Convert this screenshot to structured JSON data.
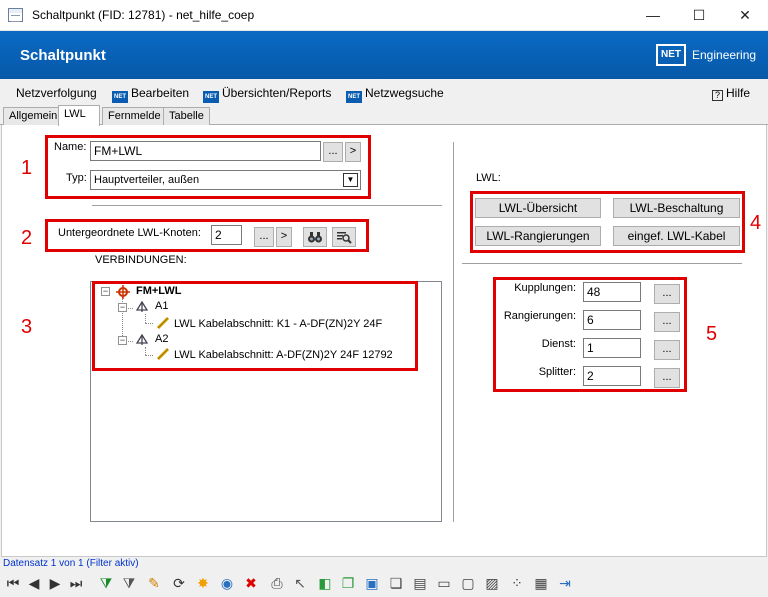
{
  "window": {
    "title": "Schaltpunkt (FID: 12781) - net_hilfe_coep",
    "minimize": "—",
    "maximize": "☐",
    "close": "✕"
  },
  "banner": {
    "title": "Schaltpunkt",
    "logo": "NET",
    "logo_text": "Engineering"
  },
  "menu": {
    "items": [
      "Netzverfolgung",
      "Bearbeiten",
      "Übersichten/Reports",
      "Netzwegsuche"
    ],
    "help": "Hilfe",
    "help_icon": "?",
    "net_icon": "NET"
  },
  "tabs": [
    "Allgemein",
    "LWL",
    "Fernmelde",
    "Tabelle"
  ],
  "active_tab": "LWL",
  "form": {
    "name_label": "Name:",
    "name_value": "FM+LWL",
    "name_more": "...",
    "name_go": ">",
    "typ_label": "Typ:",
    "typ_value": "Hauptverteiler, außen",
    "typ_dropdown": "▼",
    "sub_label": "Untergeordnete LWL-Knoten:",
    "sub_value": "2",
    "sub_more": "...",
    "sub_go": ">",
    "connections_label": "VERBINDUNGEN:"
  },
  "tree": {
    "expander": "−",
    "root": "FM+LWL",
    "children": [
      {
        "label": "A1",
        "cable": "LWL Kabelabschnitt: K1 - A-DF(ZN)2Y 24F"
      },
      {
        "label": "A2",
        "cable": "LWL Kabelabschnitt: A-DF(ZN)2Y 24F 12792"
      }
    ]
  },
  "lwl": {
    "label": "LWL:",
    "buttons": [
      "LWL-Übersicht",
      "LWL-Beschaltung",
      "LWL-Rangierungen",
      "eingef. LWL-Kabel"
    ]
  },
  "counts": {
    "more": "...",
    "rows": [
      {
        "label": "Kupplungen:",
        "value": "48"
      },
      {
        "label": "Rangierungen:",
        "value": "6"
      },
      {
        "label": "Dienst:",
        "value": "1"
      },
      {
        "label": "Splitter:",
        "value": "2"
      }
    ]
  },
  "markers": [
    "1",
    "2",
    "3",
    "4",
    "5"
  ],
  "status": "Datensatz 1 von 1 (Filter aktiv)",
  "toolbar_icons": [
    {
      "name": "first-record-icon",
      "glyph": "⏮",
      "color": "#333333"
    },
    {
      "name": "previous-record-icon",
      "glyph": "◀",
      "color": "#333333"
    },
    {
      "name": "next-record-icon",
      "glyph": "▶",
      "color": "#333333"
    },
    {
      "name": "last-record-icon",
      "glyph": "⏭",
      "color": "#333333"
    },
    {
      "name": "add-filter-icon",
      "glyph": "⧩",
      "color": "#1a8a2a"
    },
    {
      "name": "filter-icon",
      "glyph": "⧩",
      "color": "#555555"
    },
    {
      "name": "edit-pencil-icon",
      "glyph": "✎",
      "color": "#d08000"
    },
    {
      "name": "refresh-icon",
      "glyph": "⟳",
      "color": "#333333"
    },
    {
      "name": "new-record-icon",
      "glyph": "✸",
      "color": "#f0a000"
    },
    {
      "name": "globe-icon",
      "glyph": "◉",
      "color": "#2a70c0"
    },
    {
      "name": "delete-icon",
      "glyph": "✖",
      "color": "#e00000"
    },
    {
      "name": "print-icon",
      "glyph": "⎙",
      "color": "#444444"
    },
    {
      "name": "select-icon",
      "glyph": "↖",
      "color": "#555555"
    },
    {
      "name": "box-icon",
      "glyph": "◧",
      "color": "#2a9a3a"
    },
    {
      "name": "copy-icon",
      "glyph": "❐",
      "color": "#2a9a3a"
    },
    {
      "name": "frame-icon",
      "glyph": "▣",
      "color": "#2a70c0"
    },
    {
      "name": "window-copy-icon",
      "glyph": "❏",
      "color": "#444444"
    },
    {
      "name": "new-document-icon",
      "glyph": "▤",
      "color": "#444444"
    },
    {
      "name": "document-icon",
      "glyph": "▭",
      "color": "#444444"
    },
    {
      "name": "document-star-icon",
      "glyph": "▢",
      "color": "#444444"
    },
    {
      "name": "image-add-icon",
      "glyph": "▨",
      "color": "#444444"
    },
    {
      "name": "network-icon",
      "glyph": "⁘",
      "color": "#444444"
    },
    {
      "name": "table-icon",
      "glyph": "▦",
      "color": "#444444"
    },
    {
      "name": "exit-icon",
      "glyph": "⇥",
      "color": "#2a70c0"
    }
  ]
}
